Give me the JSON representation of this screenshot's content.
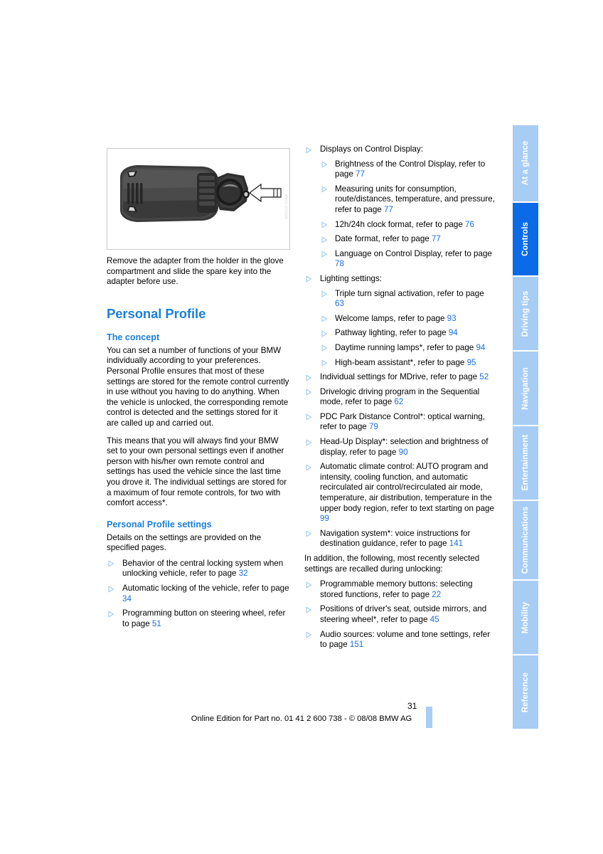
{
  "document": {
    "page_number": "31",
    "footer_text": "Online Edition for Part no. 01 41 2 600 738 - © 08/08 BMW AG"
  },
  "tabs": [
    {
      "label": "At a glance",
      "active": false
    },
    {
      "label": "Controls",
      "active": true
    },
    {
      "label": "Driving tips",
      "active": false
    },
    {
      "label": "Navigation",
      "active": false
    },
    {
      "label": "Entertainment",
      "active": false
    },
    {
      "label": "Communications",
      "active": false
    },
    {
      "label": "Mobility",
      "active": false
    },
    {
      "label": "Reference",
      "active": false
    }
  ],
  "figure": {
    "alt": "remote-control-key-adapter-photo",
    "watermark": "WKD00 HO5A",
    "caption": "Remove the adapter from the holder in the glove compartment and slide the spare key into the adapter before use."
  },
  "left_column": {
    "section_title": "Personal Profile",
    "concept_heading": "The concept",
    "concept_paragraph_1": "You can set a number of functions of your BMW individually according to your preferences. Personal Profile ensures that most of these settings are stored for the remote control currently in use without you having to do anything. When the vehicle is unlocked, the corresponding remote control is detected and the settings stored for it are called up and carried out.",
    "concept_paragraph_2": "This means that you will always find your BMW set to your own personal settings even if another person with his/her own remote control and settings has used the vehicle since the last time you drove it. The individual settings are stored for a maximum of four remote controls, for two with comfort access*.",
    "settings_heading": "Personal Profile settings",
    "settings_intro": "Details on the settings are provided on the specified pages.",
    "settings_items": [
      {
        "text_before": "Behavior of the central locking system when unlocking vehicle, refer to page ",
        "page": "32",
        "text_after": ""
      },
      {
        "text_before": "Automatic locking of the vehicle, refer to page ",
        "page": "34",
        "text_after": ""
      },
      {
        "text_before": "Programming button on steering wheel, refer to page ",
        "page": "51",
        "text_after": ""
      }
    ]
  },
  "right_column": {
    "items": [
      {
        "text_before": "Displays on Control Display:",
        "page": "",
        "text_after": "",
        "children": [
          {
            "text_before": "Brightness of the Control Display, refer to page ",
            "page": "77",
            "text_after": ""
          },
          {
            "text_before": "Measuring units for consumption, route/distances, temperature, and pressure, refer to page ",
            "page": "77",
            "text_after": ""
          },
          {
            "text_before": "12h/24h clock format, refer to page ",
            "page": "76",
            "text_after": ""
          },
          {
            "text_before": "Date format, refer to page ",
            "page": "77",
            "text_after": ""
          },
          {
            "text_before": "Language on Control Display, refer to page ",
            "page": "78",
            "text_after": ""
          }
        ]
      },
      {
        "text_before": "Lighting settings:",
        "page": "",
        "text_after": "",
        "children": [
          {
            "text_before": "Triple turn signal activation, refer to page ",
            "page": "63",
            "text_after": ""
          },
          {
            "text_before": "Welcome lamps, refer to page ",
            "page": "93",
            "text_after": ""
          },
          {
            "text_before": "Pathway lighting, refer to page ",
            "page": "94",
            "text_after": ""
          },
          {
            "text_before": "Daytime running lamps*, refer to page ",
            "page": "94",
            "text_after": ""
          },
          {
            "text_before": "High-beam assistant*, refer to page ",
            "page": "95",
            "text_after": ""
          }
        ]
      },
      {
        "text_before": "Individual settings for MDrive, refer to page ",
        "page": "52",
        "text_after": "",
        "children": []
      },
      {
        "text_before": "Drivelogic driving program in the Sequential mode, refer to page ",
        "page": "62",
        "text_after": "",
        "children": []
      },
      {
        "text_before": "PDC Park Distance Control*: optical warning, refer to page ",
        "page": "79",
        "text_after": "",
        "children": []
      },
      {
        "text_before": "Head-Up Display*: selection and brightness of display, refer to page ",
        "page": "90",
        "text_after": "",
        "children": []
      },
      {
        "text_before": "Automatic climate control: AUTO program and intensity, cooling function, and automatic recirculated air control/recirculated air mode, temperature, air distribution, temperature in the upper body region, refer to text starting on page ",
        "page": "99",
        "text_after": "",
        "children": []
      },
      {
        "text_before": "Navigation system*: voice instructions for destination guidance, refer to page ",
        "page": "141",
        "text_after": "",
        "children": []
      }
    ],
    "recall_intro": "In addition, the following, most recently selected settings are recalled during unlocking:",
    "recall_items": [
      {
        "text_before": "Programmable memory buttons: selecting stored functions, refer to page ",
        "page": "22",
        "text_after": ""
      },
      {
        "text_before": "Positions of driver's seat, outside mirrors, and steering wheel*, refer to page ",
        "page": "45",
        "text_after": ""
      },
      {
        "text_before": "Audio sources: volume and tone settings, refer to page ",
        "page": "151",
        "text_after": ""
      }
    ]
  },
  "colors": {
    "accent_blue": "#1b7fd8",
    "link_blue": "#1b6fe0",
    "tab_inactive": "#a8cdf4",
    "tab_active": "#0a6ae8"
  }
}
